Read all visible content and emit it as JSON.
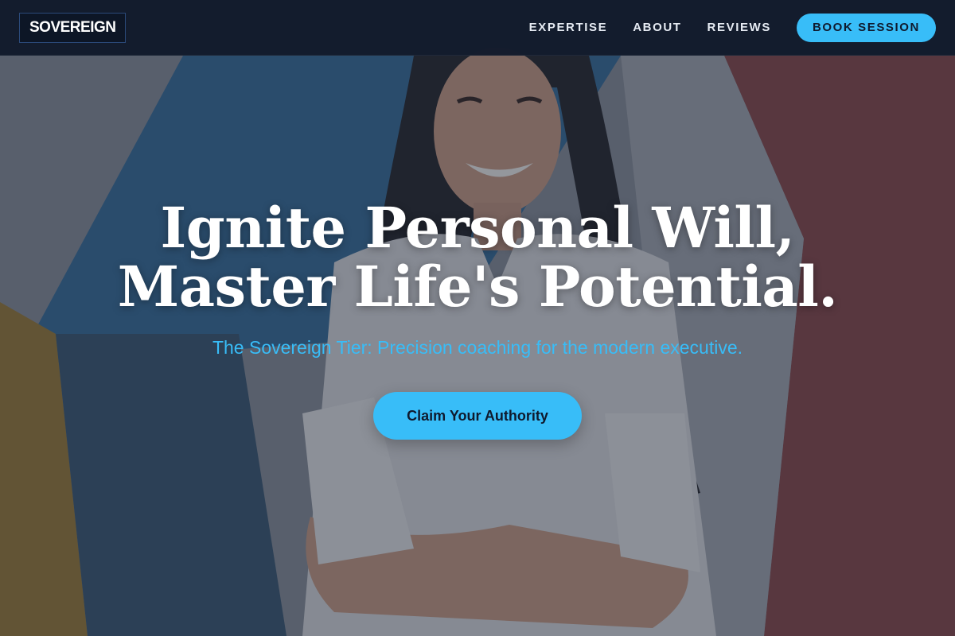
{
  "nav": {
    "logo": "SOVEREIGN",
    "links": [
      {
        "label": "EXPERTISE"
      },
      {
        "label": "ABOUT"
      },
      {
        "label": "REVIEWS"
      }
    ],
    "cta_label": "BOOK SESSION"
  },
  "hero": {
    "headline_line1": "Ignite Personal Will,",
    "headline_line2": "Master Life's Potential.",
    "subheading": "The Sovereign Tier: Precision coaching for the modern executive.",
    "cta_label": "Claim Your Authority"
  },
  "colors": {
    "accent": "#38bdf8",
    "nav_bg": "#11192b",
    "cta_text": "#0f1a2e",
    "headline": "#ffffff"
  }
}
